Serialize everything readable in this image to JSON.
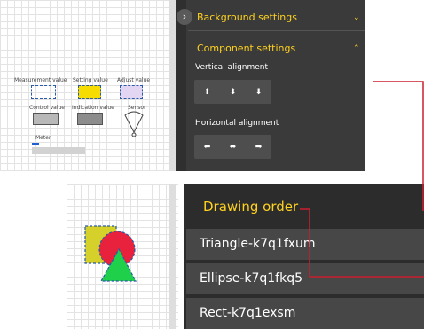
{
  "top_canvas": {
    "labels": {
      "measurement": "Measurement value",
      "setting": "Setting value",
      "adjust": "Adjust value",
      "control": "Control value",
      "indication": "Indication value",
      "sensor": "Sensor",
      "meter": "Meter"
    },
    "colors": {
      "setting_fill": "#f7dc00",
      "adjust_fill": "#e2d6f2",
      "control_fill": "#b8b8b8",
      "indication_fill": "#8c8c8c",
      "dash_border": "#2a5aa8",
      "meter_fill": "#1f5fcf",
      "meter_track": "#d2d2d2"
    },
    "meter_level": 0.13
  },
  "settings_panel": {
    "collapse_icon": "chevron-right-icon",
    "background_settings": "Background settings",
    "component_settings": "Component settings",
    "vertical_alignment": "Vertical alignment",
    "horizontal_alignment": "Horizontal alignment",
    "accent_color": "#ffd21f"
  },
  "drawing_order": {
    "title": "Drawing order",
    "items": [
      "Triangle-k7q1fxum",
      "Ellipse-k7q1fkq5",
      "Rect-k7q1exsm"
    ]
  },
  "bottom_canvas": {
    "rect_fill": "#d6d12a",
    "ellipse_fill": "#e8223c",
    "triangle_fill": "#1fd14a"
  },
  "connector_color": "#cc1f2e"
}
